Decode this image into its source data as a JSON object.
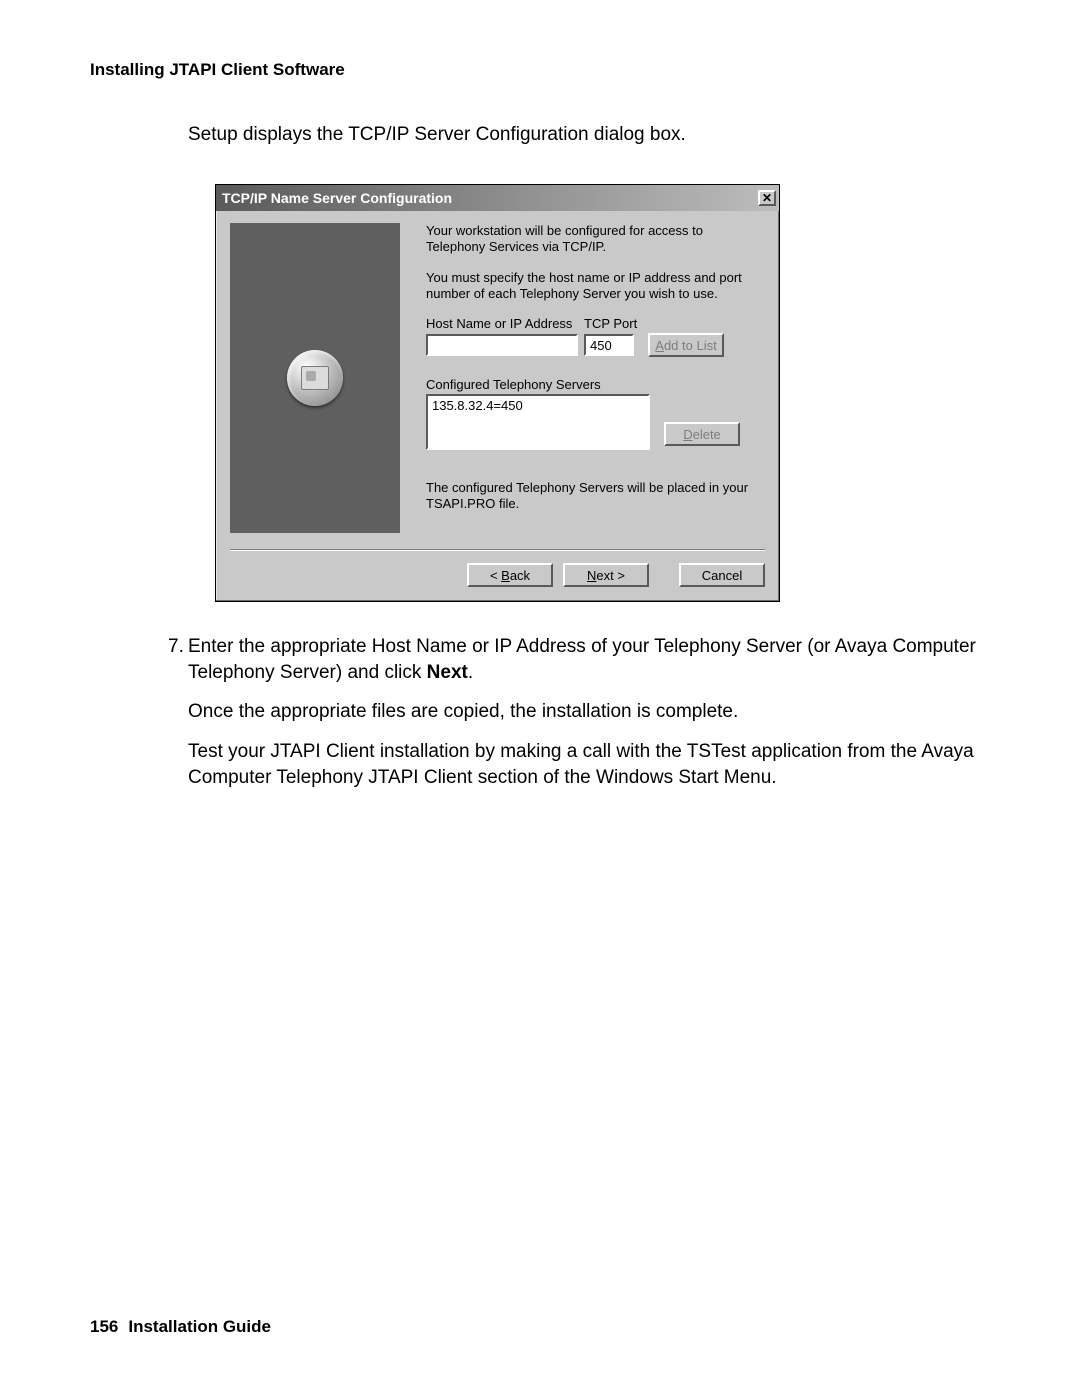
{
  "header": "Installing JTAPI Client Software",
  "intro": "Setup displays the TCP/IP Server Configuration dialog box.",
  "dialog": {
    "title": "TCP/IP Name Server Configuration",
    "close_label": "✕",
    "para1": "Your workstation will be configured for access to Telephony Services via TCP/IP.",
    "para2": "You must specify the host name or IP address and port number of each Telephony Server you wish to use.",
    "host_label": "Host Name or IP Address",
    "port_label": "TCP Port",
    "host_value": "",
    "port_value": "450",
    "add_btn_prefix": "A",
    "add_btn_rest": "dd to List",
    "cfg_label": "Configured Telephony Servers",
    "server_entry": "135.8.32.4=450",
    "del_btn_prefix": "D",
    "del_btn_rest": "elete",
    "footer_note": "The configured Telephony Servers will be placed in your TSAPI.PRO file.",
    "back_prefix": "< ",
    "back_u": "B",
    "back_rest": "ack",
    "next_u": "N",
    "next_rest": "ext >",
    "cancel": "Cancel"
  },
  "step7_num": "7.",
  "step7_a": "Enter the appropriate Host Name or IP Address of your Telephony Server (or Avaya Computer Telephony Server) and click ",
  "step7_b": "Next",
  "step7_c": ".",
  "after1": "Once the appropriate files are copied, the installation is complete.",
  "after2": "Test your JTAPI Client installation by making a call with the TSTest application from the Avaya Computer Telephony JTAPI Client section of the Windows Start Menu.",
  "footer_page": "156",
  "footer_text": "Installation Guide"
}
